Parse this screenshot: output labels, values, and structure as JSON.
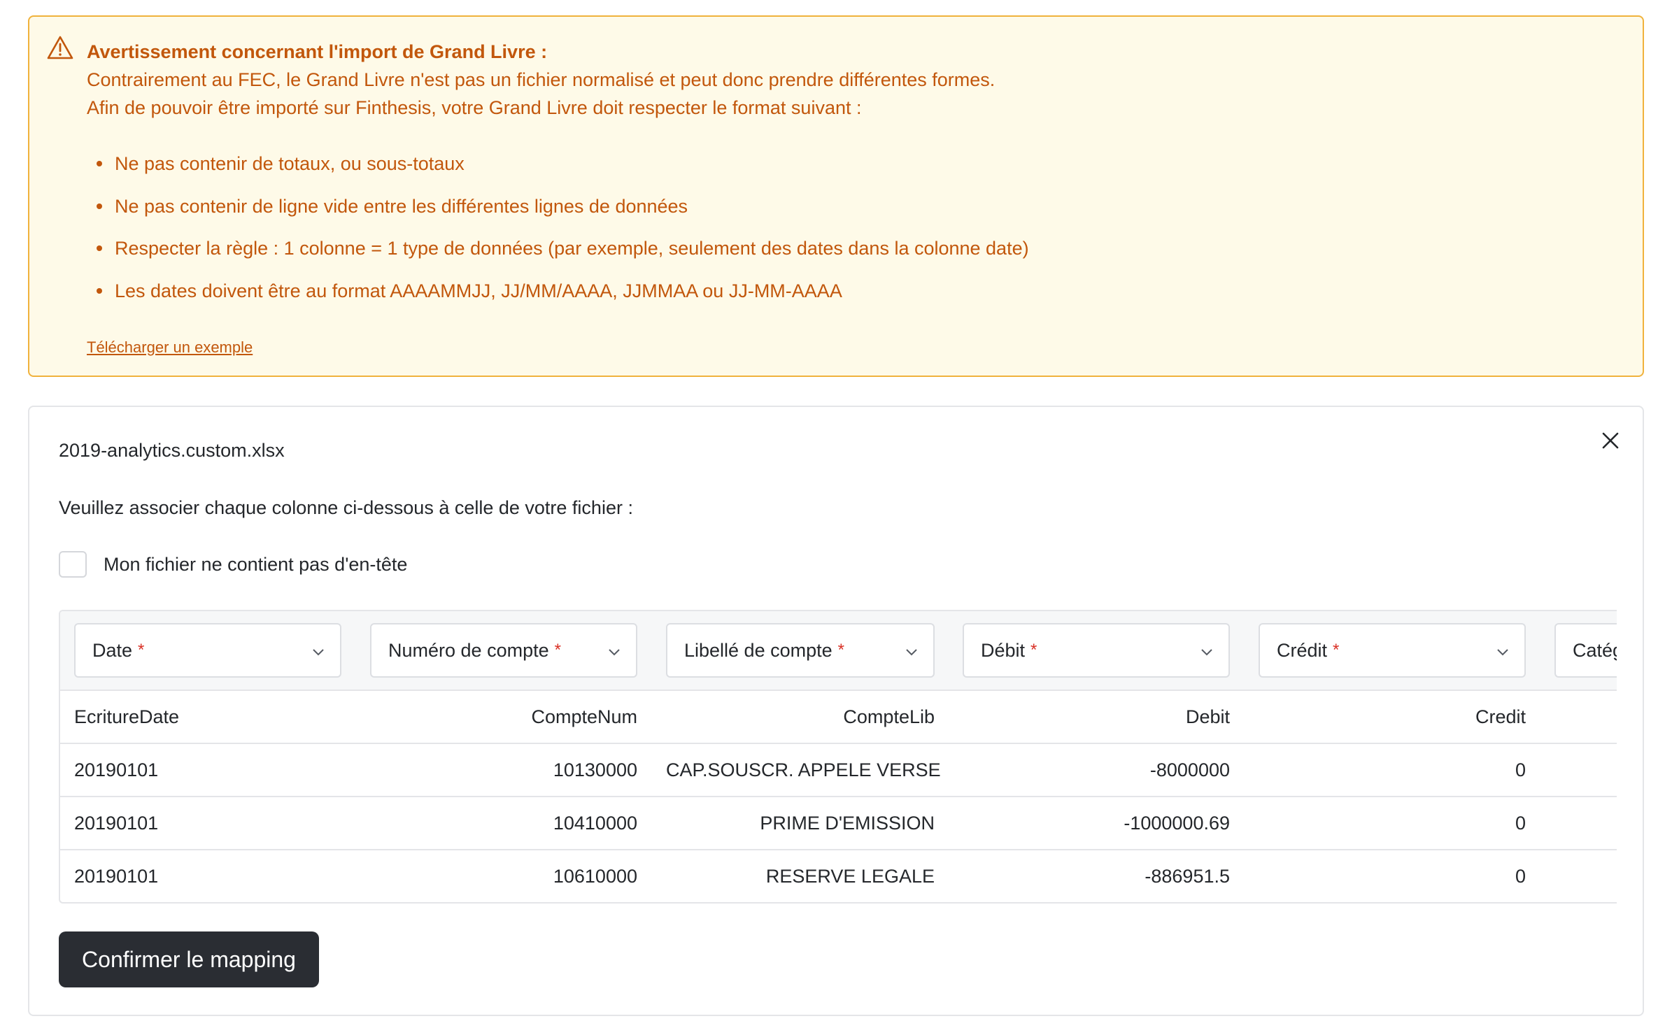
{
  "warning": {
    "title": "Avertissement concernant l'import de Grand Livre :",
    "line1": "Contrairement au FEC, le Grand Livre n'est pas un fichier normalisé et peut donc prendre différentes formes.",
    "line2": "Afin de pouvoir être importé sur Finthesis, votre Grand Livre doit respecter le format suivant :",
    "rules": [
      "Ne pas contenir de totaux, ou sous-totaux",
      "Ne pas contenir de ligne vide entre les différentes lignes de données",
      "Respecter la règle : 1 colonne = 1 type de données (par exemple, seulement des dates dans la colonne date)",
      "Les dates doivent être au format AAAAMMJJ, JJ/MM/AAAA, JJMMAA ou JJ-MM-AAAA"
    ],
    "download_link": "Télécharger un exemple"
  },
  "card": {
    "filename": "2019-analytics.custom.xlsx",
    "instruction": "Veuillez associer chaque colonne ci-dessous à celle de votre fichier :",
    "no_header_label": "Mon fichier ne contient pas d'en-tête",
    "required_marker": "*",
    "selects": [
      {
        "label": "Date",
        "required": true
      },
      {
        "label": "Numéro de compte",
        "required": true
      },
      {
        "label": "Libellé de compte",
        "required": true
      },
      {
        "label": "Débit",
        "required": true
      },
      {
        "label": "Crédit",
        "required": true
      },
      {
        "label": "Catég",
        "required": false
      }
    ],
    "columns": [
      "EcritureDate",
      "CompteNum",
      "CompteLib",
      "Debit",
      "Credit"
    ],
    "rows": [
      [
        "20190101",
        "10130000",
        "CAP.SOUSCR. APPELE VERSE",
        "-8000000",
        "0"
      ],
      [
        "20190101",
        "10410000",
        "PRIME D'EMISSION",
        "-1000000.69",
        "0"
      ],
      [
        "20190101",
        "10610000",
        "RESERVE LEGALE",
        "-886951.5",
        "0"
      ]
    ],
    "confirm_label": "Confirmer le mapping"
  },
  "colors": {
    "warning_bg": "#fefae8",
    "warning_border": "#f0b23c",
    "warning_text": "#c2570c",
    "required": "#d93025",
    "primary_button": "#2a2d33"
  }
}
